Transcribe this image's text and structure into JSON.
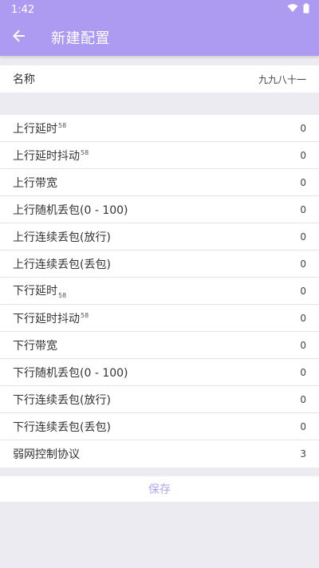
{
  "status_bar": {
    "time": "1:42"
  },
  "app_bar": {
    "title": "新建配置",
    "back_icon": "arrow-left-icon"
  },
  "name_row": {
    "label": "名称",
    "value": "九九八十一"
  },
  "rows": [
    {
      "label": "上行延时",
      "mark": "58",
      "mark_type": "sup",
      "value": "0"
    },
    {
      "label": "上行延时抖动",
      "mark": "58",
      "mark_type": "sup",
      "value": "0"
    },
    {
      "label": "上行带宽",
      "mark": "",
      "mark_type": "",
      "value": "0"
    },
    {
      "label": "上行随机丢包(0 - 100)",
      "mark": "",
      "mark_type": "",
      "value": "0"
    },
    {
      "label": "上行连续丢包(放行)",
      "mark": "",
      "mark_type": "",
      "value": "0"
    },
    {
      "label": "上行连续丢包(丢包)",
      "mark": "",
      "mark_type": "",
      "value": "0"
    },
    {
      "label": "下行延时",
      "mark": "58",
      "mark_type": "sub",
      "value": "0"
    },
    {
      "label": "下行延时抖动",
      "mark": "58",
      "mark_type": "sup",
      "value": "0"
    },
    {
      "label": "下行带宽",
      "mark": "",
      "mark_type": "",
      "value": "0"
    },
    {
      "label": "下行随机丢包(0 - 100)",
      "mark": "",
      "mark_type": "",
      "value": "0"
    },
    {
      "label": "下行连续丢包(放行)",
      "mark": "",
      "mark_type": "",
      "value": "0"
    },
    {
      "label": "下行连续丢包(丢包)",
      "mark": "",
      "mark_type": "",
      "value": "0"
    },
    {
      "label": "弱网控制协议",
      "mark": "",
      "mark_type": "",
      "value": "3"
    }
  ],
  "save_label": "保存",
  "colors": {
    "accent": "#ad9bf2",
    "background": "#ecebf1",
    "save_text": "#b2a3ee"
  }
}
